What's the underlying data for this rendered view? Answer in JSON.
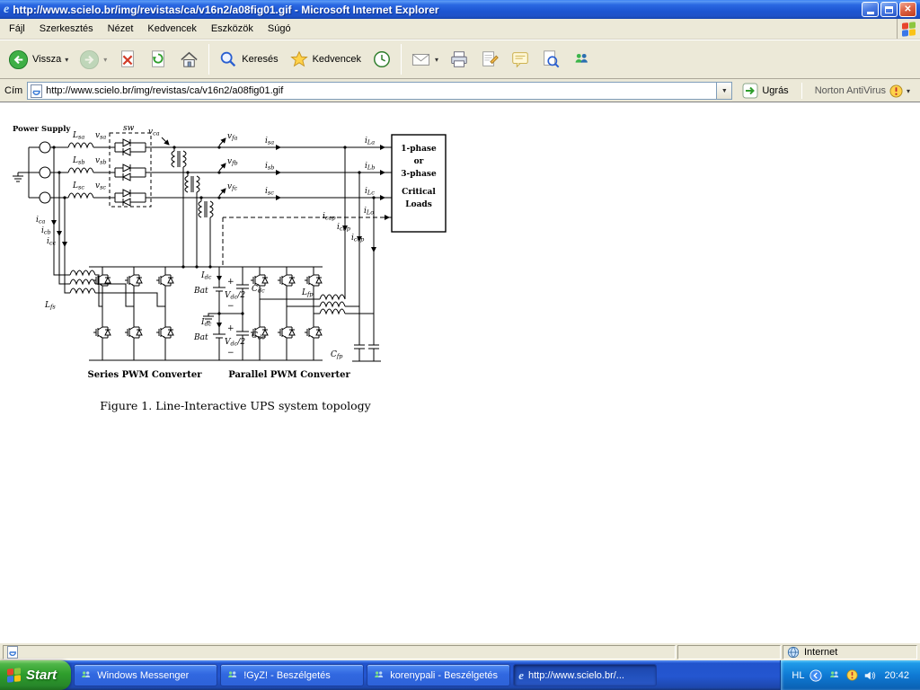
{
  "titlebar": {
    "title": "http://www.scielo.br/img/revistas/ca/v16n2/a08fig01.gif - Microsoft Internet Explorer"
  },
  "menubar": {
    "items": [
      "Fájl",
      "Szerkesztés",
      "Nézet",
      "Kedvencek",
      "Eszközök",
      "Súgó"
    ]
  },
  "toolbar": {
    "back_label": "Vissza",
    "search_label": "Keresés",
    "favorites_label": "Kedvencek"
  },
  "addressbar": {
    "label": "Cím",
    "url": "http://www.scielo.br/img/revistas/ca/v16n2/a08fig01.gif",
    "go_label": "Ugrás",
    "norton_label": "Norton AntiVirus"
  },
  "content": {
    "caption": "Figure 1. Line-Interactive UPS system topology",
    "diagram": {
      "power_supply": "Power Supply",
      "sw": "sw",
      "lsa": {
        "m": "L",
        "s": "sa"
      },
      "lsb": {
        "m": "L",
        "s": "sb"
      },
      "lsc": {
        "m": "L",
        "s": "sc"
      },
      "vsa": {
        "m": "v",
        "s": "sa"
      },
      "vsb": {
        "m": "v",
        "s": "sb"
      },
      "vsc": {
        "m": "v",
        "s": "sc"
      },
      "vca": {
        "m": "v",
        "s": "ca"
      },
      "vfa": {
        "m": "v",
        "s": "fa"
      },
      "vfb": {
        "m": "v",
        "s": "fb"
      },
      "vfc": {
        "m": "v",
        "s": "fc"
      },
      "isa": {
        "m": "i",
        "s": "sa"
      },
      "isb": {
        "m": "i",
        "s": "sb"
      },
      "isc": {
        "m": "i",
        "s": "sc"
      },
      "ila": {
        "m": "i",
        "s": "La"
      },
      "ilb": {
        "m": "i",
        "s": "Lb"
      },
      "ilc": {
        "m": "i",
        "s": "Lc"
      },
      "ilo": {
        "m": "i",
        "s": "Lo"
      },
      "ica": {
        "m": "i",
        "s": "ca"
      },
      "icb": {
        "m": "i",
        "s": "cb"
      },
      "icc": {
        "m": "i",
        "s": "cc"
      },
      "icap": {
        "m": "i",
        "s": "cap"
      },
      "icbp": {
        "m": "i",
        "s": "cbp"
      },
      "iccp": {
        "m": "i",
        "s": "ccp"
      },
      "idc": {
        "m": "I",
        "s": "dc"
      },
      "bat": "Bat",
      "vdc": {
        "m": "V",
        "s": "dc",
        "t": "/2"
      },
      "cdc": {
        "m": "C",
        "s": "dc"
      },
      "lfs": {
        "m": "L",
        "s": "fs"
      },
      "lfp": {
        "m": "L",
        "s": "fp"
      },
      "cfp": {
        "m": "C",
        "s": "fp"
      },
      "plus": "+",
      "minus": "−",
      "loads": {
        "l1": "1-phase",
        "l2": "or",
        "l3": "3-phase",
        "l4": "Critical",
        "l5": "Loads"
      },
      "series_label": "Series PWM Converter",
      "parallel_label": "Parallel PWM Converter"
    }
  },
  "statusbar": {
    "zone": "Internet"
  },
  "taskbar": {
    "start_label": "Start",
    "tasks": [
      {
        "label": "Windows Messenger"
      },
      {
        "label": "!GyZ! - Beszélgetés"
      },
      {
        "label": "korenypali - Beszélgetés"
      },
      {
        "label": "http://www.scielo.br/..."
      }
    ],
    "tray": {
      "lang": "HL",
      "time": "20:42"
    }
  }
}
